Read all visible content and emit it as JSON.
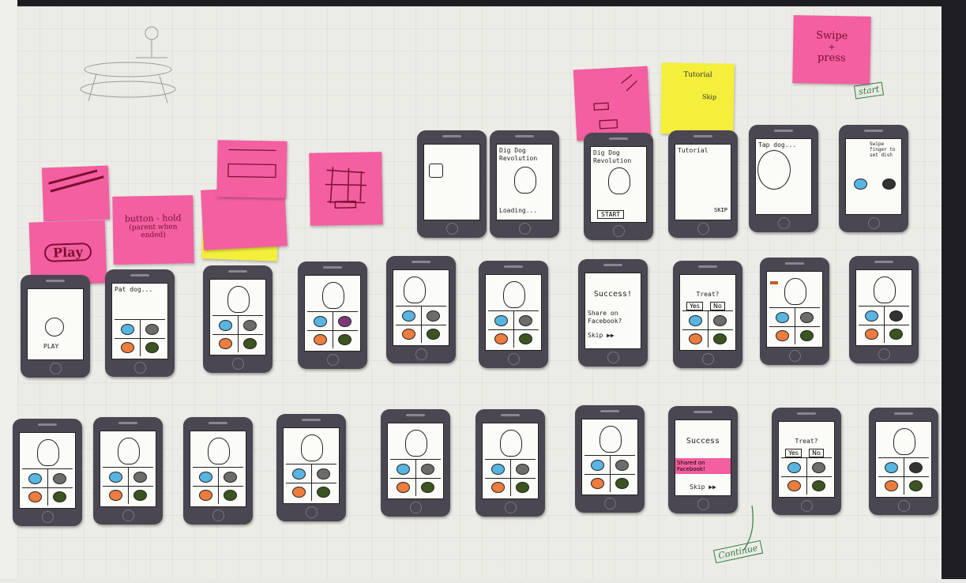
{
  "notes": {
    "play": "Play",
    "button_text_1": "button - hold",
    "button_text_2": "(parent when",
    "button_text_3": "ended)",
    "swipe_1": "Swipe",
    "swipe_2": "+",
    "swipe_3": "press",
    "tutorial": "Tutorial",
    "skip": "Skip",
    "start_box": "start",
    "continue_box": "Continue"
  },
  "screens": {
    "row1": {
      "title_a": "Dig Dog Revolution",
      "loading": "Loading...",
      "title_b": "Dig Dog Revolution",
      "start": "START",
      "tutorial": "Tutorial",
      "skip": "SKIP",
      "dog_tap": "Tap dog...",
      "swipe_hint": "Swipe finger to set dish"
    },
    "row2": {
      "play": "PLAY",
      "pat_dog": "Pat dog...",
      "success": "Success!",
      "share": "Share on Facebook?",
      "skip": "Skip ▶▶",
      "treat": "Treat?",
      "yes": "Yes",
      "no": "No"
    },
    "row3": {
      "success": "Success",
      "shared": "Shared on Facebook!",
      "skip": "Skip ▶▶",
      "treat": "Treat?",
      "yes": "Yes",
      "no": "No"
    }
  },
  "colors": {
    "pink_note": "#f35fa0",
    "yellow_note": "#f4ef3a",
    "phone_body": "#4a4652",
    "blue_blob": "#58b4e0",
    "grey_blob": "#6c6c6c",
    "orange_blob": "#ec7d3e",
    "green_blob": "#3b5420",
    "annotation_green": "#2f7a42"
  }
}
